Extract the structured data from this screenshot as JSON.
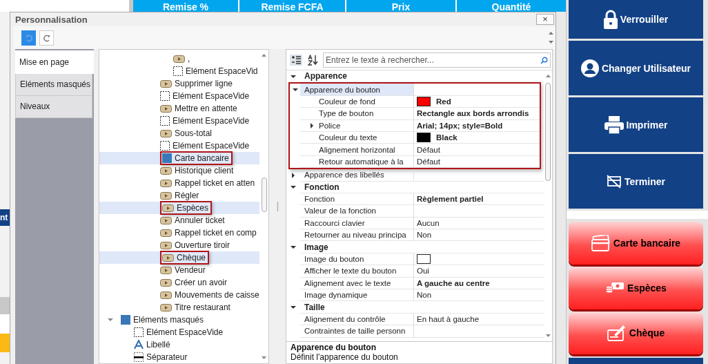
{
  "background": {
    "columns": [
      "Remise %",
      "Remise FCFA",
      "Prix",
      "Quantité"
    ],
    "side_label": "nt"
  },
  "dialog": {
    "title": "Personnalisation",
    "close": "×",
    "tabs": [
      {
        "label": "Mise en page",
        "selected": true
      },
      {
        "label": "Eléments masqués",
        "selected": false
      },
      {
        "label": "Niveaux",
        "selected": false
      }
    ],
    "tree": {
      "items": [
        {
          "children": [
            {
              "children": [
                {
                  "children": [
                    {
                      "children": [
                        {
                          "label": ",",
                          "kind": "button",
                          "selected": false,
                          "outlined": false
                        },
                        {
                          "label": "Elément EspaceVid",
                          "kind": "spacer",
                          "selected": false,
                          "outlined": false
                        }
                      ]
                    },
                    {
                      "label": "Supprimer ligne",
                      "kind": "button",
                      "selected": false,
                      "outlined": false
                    },
                    {
                      "label": "Elément EspaceVide",
                      "kind": "spacer",
                      "selected": false,
                      "outlined": false
                    },
                    {
                      "label": "Mettre en attente",
                      "kind": "button",
                      "selected": false,
                      "outlined": false
                    },
                    {
                      "label": "Elément EspaceVide",
                      "kind": "spacer",
                      "selected": false,
                      "outlined": false
                    },
                    {
                      "label": "Sous-total",
                      "kind": "button",
                      "selected": false,
                      "outlined": false
                    },
                    {
                      "label": "Elément EspaceVide",
                      "kind": "spacer",
                      "selected": false,
                      "outlined": false
                    },
                    {
                      "label": "Carte bancaire",
                      "kind": "panel",
                      "selected": true,
                      "outlined": true
                    },
                    {
                      "label": "Historique client",
                      "kind": "button",
                      "selected": false,
                      "outlined": false
                    },
                    {
                      "label": "Rappel ticket en atten",
                      "kind": "button",
                      "selected": false,
                      "outlined": false
                    },
                    {
                      "label": "Régler",
                      "kind": "button",
                      "selected": false,
                      "outlined": false
                    },
                    {
                      "label": "Espèces",
                      "kind": "button",
                      "selected": true,
                      "outlined": true
                    },
                    {
                      "label": "Annuler ticket",
                      "kind": "button",
                      "selected": false,
                      "outlined": false
                    },
                    {
                      "label": "Rappel ticket en comp",
                      "kind": "button",
                      "selected": false,
                      "outlined": false
                    },
                    {
                      "label": "Ouverture tiroir",
                      "kind": "button",
                      "selected": false,
                      "outlined": false
                    },
                    {
                      "label": "Chèque",
                      "kind": "button",
                      "selected": true,
                      "outlined": true
                    },
                    {
                      "label": "Vendeur",
                      "kind": "button",
                      "selected": false,
                      "outlined": false
                    },
                    {
                      "label": "Créer un avoir",
                      "kind": "button",
                      "selected": false,
                      "outlined": false
                    },
                    {
                      "label": "Mouvements de caisse",
                      "kind": "button",
                      "selected": false,
                      "outlined": false
                    },
                    {
                      "label": "Titre restaurant",
                      "kind": "button",
                      "selected": false,
                      "outlined": false
                    }
                  ]
                }
              ]
            }
          ]
        },
        {
          "label": "Eléments masqués",
          "kind": "panel",
          "selected": false,
          "outlined": false,
          "expanded": true,
          "children": [
            {
              "label": "Elément EspaceVide",
              "kind": "spacer",
              "selected": false,
              "outlined": false
            },
            {
              "label": "Libellé",
              "kind": "label",
              "selected": false,
              "outlined": false
            },
            {
              "label": "Séparateur",
              "kind": "separator",
              "selected": false,
              "outlined": false
            }
          ]
        }
      ]
    },
    "properties": {
      "search": {
        "placeholder": "Entrez le texte à rechercher..."
      },
      "categories": [
        {
          "name": "Apparence",
          "expanded": true,
          "children": [
            {
              "name": "Apparence du bouton",
              "selected": true,
              "outlined": true,
              "expanded": true,
              "children": [
                {
                  "name": "Couleur de fond",
                  "value": "Red",
                  "color": "#ff0000",
                  "modified": true,
                  "selected": false
                },
                {
                  "name": "Type de bouton",
                  "value": "Rectangle aux bords arrondis",
                  "modified": true,
                  "selected": false
                },
                {
                  "name": "Police",
                  "value": "Arial; 14px; style=Bold",
                  "expanded": false,
                  "modified": true,
                  "selected": false
                },
                {
                  "name": "Couleur du texte",
                  "value": "Black",
                  "color": "#000000",
                  "modified": true,
                  "selected": false
                },
                {
                  "name": "Alignement horizontal",
                  "value": "Défaut",
                  "modified": false,
                  "selected": false
                },
                {
                  "name": "Retour automatique à la",
                  "value": "Défaut",
                  "modified": false,
                  "selected": false
                }
              ]
            },
            {
              "name": "Apparence des libellés",
              "selected": false,
              "outlined": false,
              "expanded": false
            }
          ]
        },
        {
          "name": "Fonction",
          "expanded": true,
          "children": [
            {
              "name": "Fonction",
              "value": "Règlement partiel",
              "modified": true,
              "selected": false,
              "outlined": false
            },
            {
              "name": "Valeur de la fonction",
              "selected": false,
              "outlined": false
            },
            {
              "name": "Raccourci clavier",
              "value": "Aucun",
              "modified": false,
              "selected": false,
              "outlined": false
            },
            {
              "name": "Retourner au niveau principa",
              "value": "Non",
              "modified": false,
              "selected": false,
              "outlined": false
            }
          ]
        },
        {
          "name": "Image",
          "expanded": true,
          "children": [
            {
              "name": "Image du bouton",
              "color": "#ffffff",
              "selected": false,
              "outlined": false
            },
            {
              "name": "Afficher le texte du bouton",
              "value": "Oui",
              "modified": false,
              "selected": false,
              "outlined": false
            },
            {
              "name": "Alignement avec le texte",
              "value": "A gauche au centre",
              "modified": true,
              "selected": false,
              "outlined": false
            },
            {
              "name": "Image dynamique",
              "value": "Non",
              "modified": false,
              "selected": false,
              "outlined": false
            }
          ]
        },
        {
          "name": "Taille",
          "expanded": true,
          "children": [
            {
              "name": "Alignement du contrôle",
              "value": "En haut à gauche",
              "modified": false,
              "selected": false,
              "outlined": false
            },
            {
              "name": "Contraintes de taille personn",
              "selected": false,
              "outlined": false
            }
          ]
        }
      ],
      "description": {
        "title": "Apparence du bouton",
        "text": "Définit l'apparence du bouton"
      }
    }
  },
  "actions": [
    {
      "label": "Verrouiller",
      "kind": "nav"
    },
    {
      "label": "Changer Utilisateur",
      "kind": "nav"
    },
    {
      "label": "Imprimer",
      "kind": "nav"
    },
    {
      "label": "Terminer",
      "kind": "nav"
    },
    {
      "label": "Carte bancaire",
      "kind": "payment"
    },
    {
      "label": "Espèces",
      "kind": "payment"
    },
    {
      "label": "Chèque",
      "kind": "payment"
    }
  ]
}
